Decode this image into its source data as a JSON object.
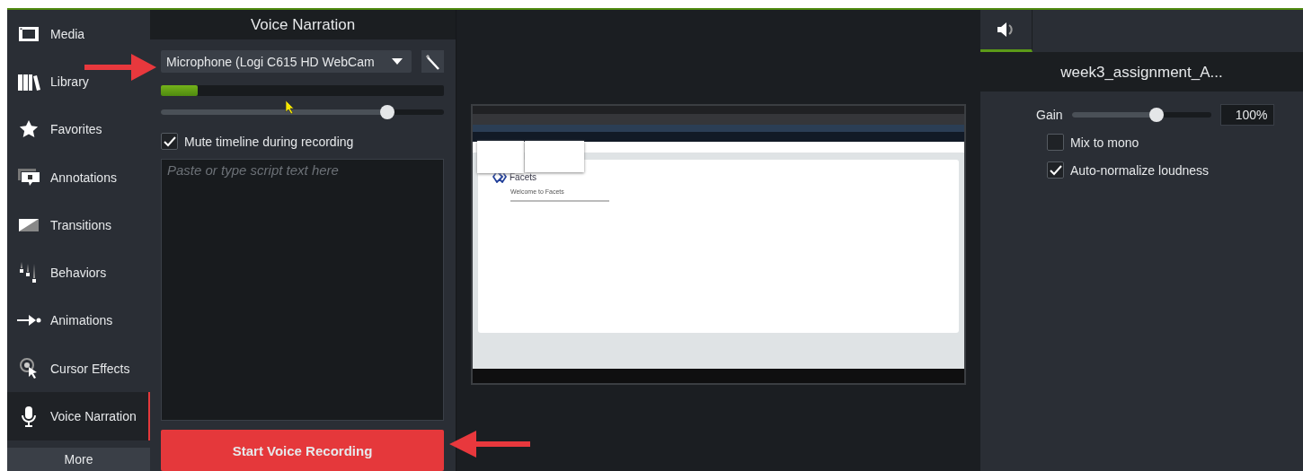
{
  "sidebar": {
    "items": [
      {
        "label": "Media",
        "selected": false
      },
      {
        "label": "Library",
        "selected": false
      },
      {
        "label": "Favorites",
        "selected": false
      },
      {
        "label": "Annotations",
        "selected": false
      },
      {
        "label": "Transitions",
        "selected": false
      },
      {
        "label": "Behaviors",
        "selected": false
      },
      {
        "label": "Animations",
        "selected": false
      },
      {
        "label": "Cursor Effects",
        "selected": false
      },
      {
        "label": "Voice Narration",
        "selected": true
      }
    ],
    "more_button": "More"
  },
  "narration": {
    "title": "Voice Narration",
    "device": "Microphone (Logi C615 HD WebCam",
    "input_meter": {
      "level": 0.13
    },
    "volume_slider": {
      "level": 0.8
    },
    "mute_timeline": {
      "label": "Mute timeline during recording",
      "checked": true
    },
    "script": {
      "placeholder": "Paste or type script text here"
    },
    "record_button": "Start Voice Recording"
  },
  "preview": {
    "logo": "Facets",
    "heading": "Welcome to Facets"
  },
  "properties": {
    "tabs": [
      {
        "selected": true
      }
    ],
    "clip_name": "week3_assignment_A...",
    "gain": {
      "label": "Gain",
      "level": 0.61,
      "value": "100%"
    },
    "options": [
      {
        "label": "Mix to mono",
        "checked": false
      },
      {
        "label": "Auto-normalize loudness",
        "checked": true
      }
    ]
  }
}
